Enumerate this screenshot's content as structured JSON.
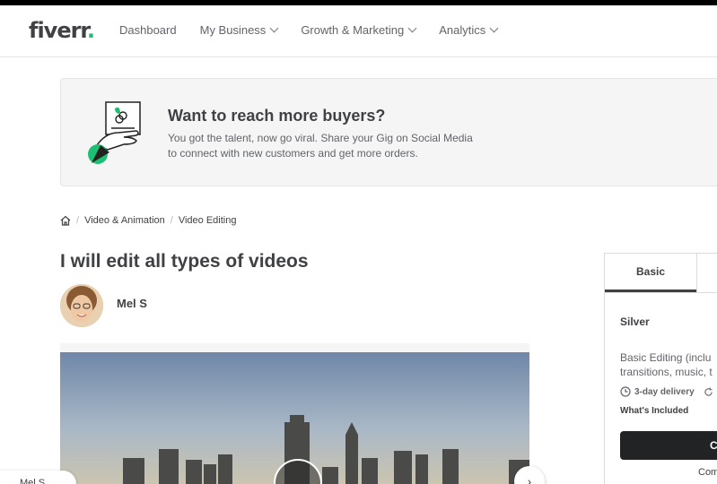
{
  "header": {
    "logo": "fiverr",
    "logo_dot": ".",
    "nav": [
      {
        "label": "Dashboard",
        "has_dropdown": false
      },
      {
        "label": "My Business",
        "has_dropdown": true
      },
      {
        "label": "Growth & Marketing",
        "has_dropdown": true
      },
      {
        "label": "Analytics",
        "has_dropdown": true
      }
    ]
  },
  "promo": {
    "title": "Want to reach more buyers?",
    "line1": "You got the talent, now go viral. Share your Gig on Social Media",
    "line2": "to connect with new customers and get more orders."
  },
  "breadcrumb": {
    "items": [
      "Video & Animation",
      "Video Editing"
    ],
    "separator": "/"
  },
  "gig": {
    "title": "I will edit all types of videos",
    "seller_name": "Mel S",
    "seller_chip": "Mel S"
  },
  "package": {
    "tab_active": "Basic",
    "name": "Silver",
    "desc_line1": "Basic Editing (inclu",
    "desc_line2": "transitions, music, t",
    "delivery": "3-day delivery",
    "included_label": "What's Included",
    "button_label": "C",
    "compare_label": "Com"
  },
  "colors": {
    "brand_green": "#1dbf73",
    "text_dark": "#404145",
    "button_dark": "#222325"
  }
}
